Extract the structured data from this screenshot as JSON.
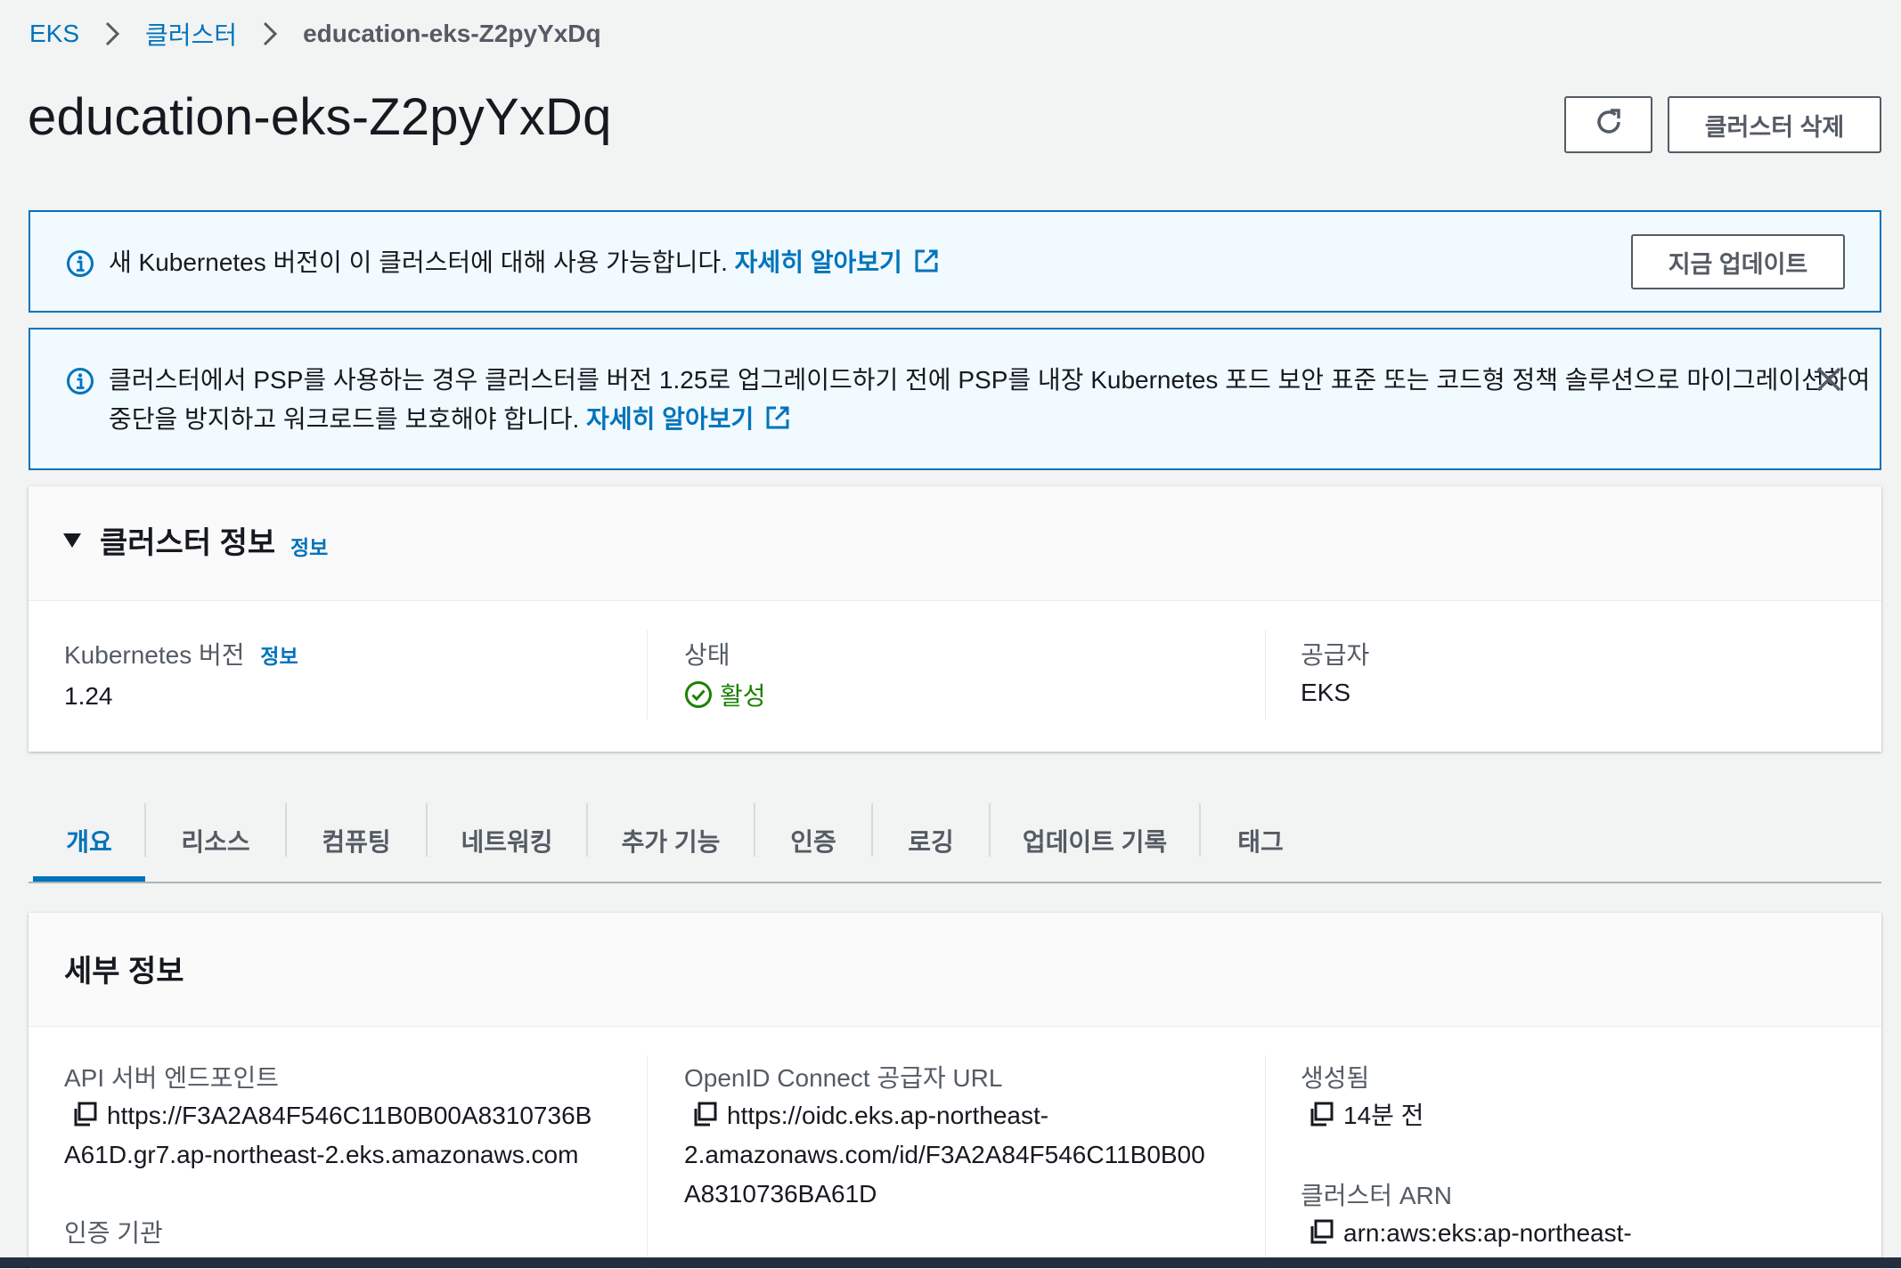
{
  "breadcrumb": {
    "root": "EKS",
    "clusters": "클러스터",
    "current": "education-eks-Z2pyYxDq"
  },
  "page": {
    "title": "education-eks-Z2pyYxDq",
    "delete_label": "클러스터 삭제"
  },
  "alert_update": {
    "message": "새 Kubernetes 버전이 이 클러스터에 대해 사용 가능합니다.",
    "link": "자세히 알아보기",
    "button": "지금 업데이트"
  },
  "alert_psp": {
    "line1": "클러스터에서 PSP를 사용하는 경우 클러스터를 버전 1.25로 업그레이드하기 전에 PSP를 내장 Kubernetes 포드 보안 표준 또는 코드형 정책 솔루션으로 마이그레이션하여",
    "line2": "중단을 방지하고 워크로드를 보호해야 합니다.",
    "link": "자세히 알아보기"
  },
  "cluster_info": {
    "title": "클러스터 정보",
    "info": "정보",
    "k8s_label": "Kubernetes 버전",
    "k8s_info": "정보",
    "k8s_value": "1.24",
    "status_label": "상태",
    "status_value": "활성",
    "provider_label": "공급자",
    "provider_value": "EKS"
  },
  "tabs": [
    "개요",
    "리소스",
    "컴퓨팅",
    "네트워킹",
    "추가 기능",
    "인증",
    "로깅",
    "업데이트 기록",
    "태그"
  ],
  "details": {
    "title": "세부 정보",
    "api_label": "API 서버 엔드포인트",
    "api_line1": "https://F3A2A84F546C11B0B00A8310736B",
    "api_line2": "A61D.gr7.ap-northeast-2.eks.amazonaws.com",
    "cert_label": "인증 기관",
    "oidc_label": "OpenID Connect 공급자 URL",
    "oidc_line1": "https://oidc.eks.ap-northeast-",
    "oidc_line2": "2.amazonaws.com/id/F3A2A84F546C11B0B00",
    "oidc_line3": "A8310736BA61D",
    "created_label": "생성됨",
    "created_value": "14분 전",
    "arn_label": "클러스터 ARN",
    "arn_value": "arn:aws:eks:ap-northeast-"
  },
  "colors": {
    "link": "#0073bb",
    "success": "#1d8102",
    "alert_bg": "#f1faff"
  }
}
